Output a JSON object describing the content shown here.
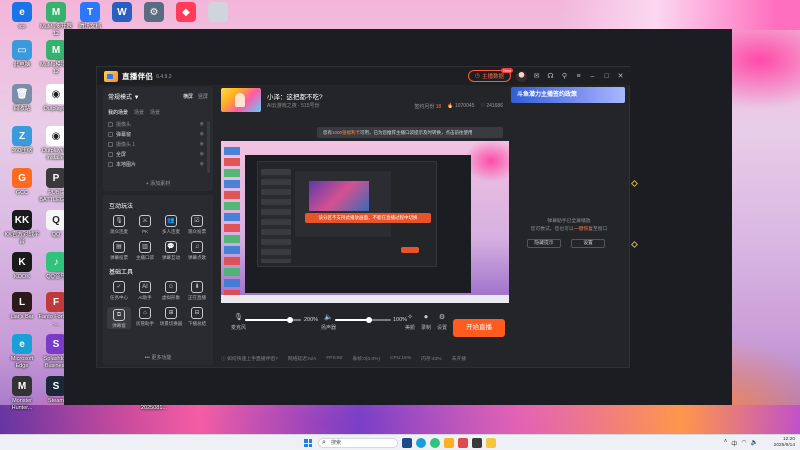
{
  "desktop": {
    "icons": [
      {
        "label": "ico",
        "color": "#1a73e8",
        "glyph": "e"
      },
      {
        "label": "MuMu多开器12",
        "color": "#35b26b",
        "glyph": "M"
      },
      {
        "label": "腾讯文档",
        "color": "#2a78ff",
        "glyph": "T"
      },
      {
        "label": "",
        "color": "#2b5fbf",
        "glyph": "W"
      },
      {
        "label": "",
        "color": "#5a6c80",
        "glyph": "⚙"
      },
      {
        "label": "",
        "color": "#ff3c5a",
        "glyph": "◆"
      },
      {
        "label": "",
        "color": "#d0d4dc",
        "glyph": ""
      },
      {
        "label": "此电脑",
        "color": "#3a9bdc",
        "glyph": "▭"
      },
      {
        "label": "MuMu模拟器12",
        "color": "#35b26b",
        "glyph": "M"
      },
      {
        "label": "回收站",
        "color": "#7a8ea8",
        "glyph": "🗑"
      },
      {
        "label": "Outplayed",
        "color": "#ffffff",
        "glyph": "◉"
      },
      {
        "label": "360压缩",
        "color": "#3a9bdc",
        "glyph": "Z"
      },
      {
        "label": "Outplayed - Installer",
        "color": "#ffffff",
        "glyph": "◉"
      },
      {
        "label": "GCC",
        "color": "#ff6a1f",
        "glyph": "G"
      },
      {
        "label": "PUBG BATTLEGR...",
        "color": "#3a3a3a",
        "glyph": "P"
      },
      {
        "label": "KK官方对战平台",
        "color": "#1a1a1a",
        "glyph": "KK"
      },
      {
        "label": "QQ",
        "color": "#f5f5f5",
        "glyph": "Q"
      },
      {
        "label": "KOOK",
        "color": "#1a1a1a",
        "glyph": "K"
      },
      {
        "label": "QQ音乐",
        "color": "#31c27c",
        "glyph": "♪"
      },
      {
        "label": "Liar's Bar",
        "color": "#2a1a1a",
        "glyph": "L"
      },
      {
        "label": "Fanto Fortune -...",
        "color": "#c03a3a",
        "glyph": "F"
      },
      {
        "label": "Microsoft Edge",
        "color": "#1aa0d8",
        "glyph": "e"
      },
      {
        "label": "Splashtop Business",
        "color": "#7a3cc8",
        "glyph": "S"
      },
      {
        "label": "Monster Hunter...",
        "color": "#333333",
        "glyph": "M"
      },
      {
        "label": "Steam",
        "color": "#1b2838",
        "glyph": "S"
      },
      {
        "label": "",
        "color": "#ffffff",
        "glyph": ""
      },
      {
        "label": "",
        "color": "#ffffff",
        "glyph": ""
      },
      {
        "label": "预览图 2025081...",
        "color": "#ffffff",
        "glyph": ""
      }
    ]
  },
  "app": {
    "title": "直播伴侣",
    "version": "6.4.9.2",
    "anchor_data_label": "主播数据",
    "new_badge": "New",
    "mode_label": "常规模式 ▼",
    "mode_right": [
      "横屏",
      "竖屏"
    ],
    "scene_tabs": [
      "我的场景",
      "场景",
      "场景"
    ],
    "sources": [
      {
        "label": "摄像头",
        "on": false
      },
      {
        "label": "弹幕窗",
        "on": true
      },
      {
        "label": "摄像头 1",
        "on": false
      },
      {
        "label": "全屏",
        "on": true
      },
      {
        "label": "本地图片",
        "on": true
      }
    ],
    "add_source": "+ 添加素材",
    "interactive_title": "互动玩法",
    "interactive_tools": [
      {
        "label": "观众连麦",
        "glyph": "🎙"
      },
      {
        "label": "PK",
        "glyph": "⚔"
      },
      {
        "label": "多人连麦",
        "glyph": "👥"
      },
      {
        "label": "观众投票",
        "glyph": "☑"
      },
      {
        "label": "弹幕投票",
        "glyph": "▤"
      },
      {
        "label": "主播口袋",
        "glyph": "▥"
      },
      {
        "label": "弹幕互动",
        "glyph": "💬"
      },
      {
        "label": "弹幕点歌",
        "glyph": "♫"
      }
    ],
    "basic_title": "基础工具",
    "basic_tools": [
      {
        "label": "任务中心",
        "glyph": "✓"
      },
      {
        "label": "AI助手",
        "glyph": "AI"
      },
      {
        "label": "虚拟形象",
        "glyph": "☺"
      },
      {
        "label": "正在直播",
        "glyph": "⬇"
      },
      {
        "label": "弹幕窗",
        "glyph": "⧉"
      },
      {
        "label": "房管助手",
        "glyph": "⌂"
      },
      {
        "label": "场景切换器",
        "glyph": "⊞"
      },
      {
        "label": "下播总结",
        "glyph": "⊟"
      }
    ],
    "more_functions": "••• 更多功能",
    "room_title": "小泽：这把都不吃?",
    "room_subtitle": "AI云游戏之夜 · 515号份",
    "room_stats": {
      "sign": "签约月份",
      "sign_val": "18",
      "fans": "1070045",
      "likes": "241686"
    },
    "notice_text": "您有",
    "notice_highlight": "1000张福利卡",
    "notice_rest": "可用，已为您推荐主播口袋提示及时转换，点击前往使用",
    "preview_alert": "该分区不支持此播放画面，不能在直播过程中切换",
    "mic_label": "麦克风",
    "mic_pct": "200%",
    "mic_fraction": 0.8,
    "speaker_label": "扬声器",
    "speaker_pct": "100%",
    "speaker_fraction": 0.6,
    "beauty_label": "美颜",
    "record_label": "录制",
    "settings_label": "设置",
    "start_live_label": "开始直播",
    "status_items": [
      "如何快速上手直播伴侣?",
      "网络延迟:N/A",
      "FPS:60",
      "丢帧:0(0.0%)",
      "CPU:15%",
      "内存:43%",
      "未开播"
    ],
    "right_banner": "斗鱼潜力主播签约政策",
    "right_empty_1": "弹幕助手已全屏播放",
    "right_empty_2": "您可尝试，您也可以",
    "right_empty_link": "一键恢复",
    "right_empty_3": "至窗口",
    "right_btn_hide": "隐藏提示",
    "right_btn_settings": "设置"
  },
  "taskbar": {
    "search_placeholder": "搜索",
    "time": "12:20",
    "date": "2025/9/14",
    "lang": "中"
  }
}
